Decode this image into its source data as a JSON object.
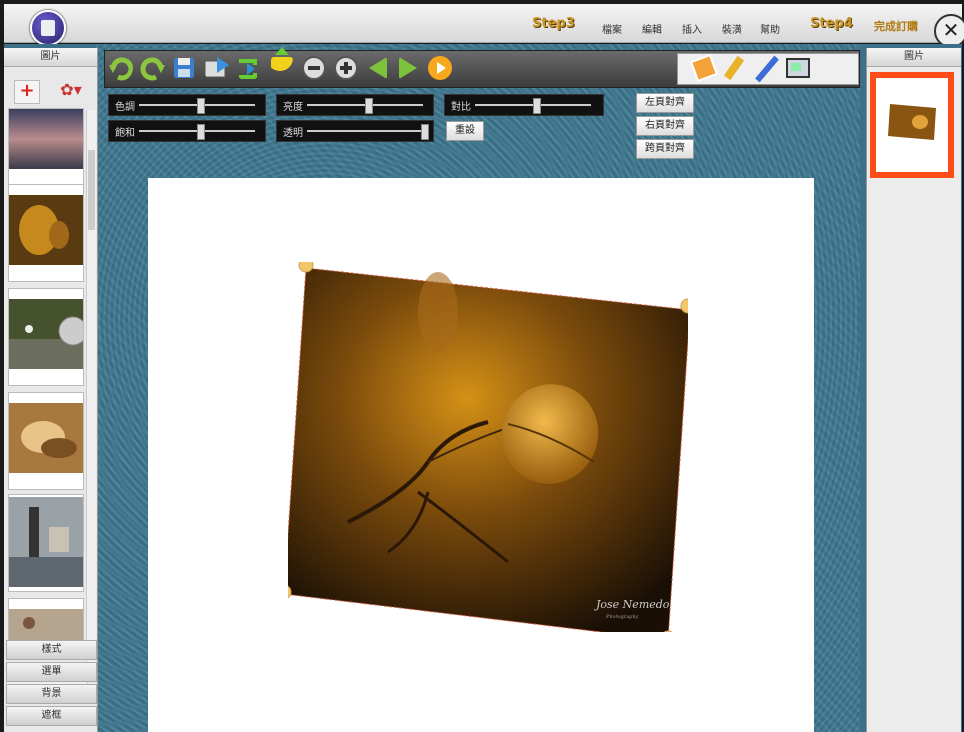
{
  "header": {
    "step3": "Step3",
    "menu": [
      "檔案",
      "編輯",
      "插入",
      "裝潢",
      "幫助"
    ],
    "step4": "Step4",
    "finish": "完成訂購",
    "close": "✕"
  },
  "left_panel": {
    "title": "圖片",
    "add_label": "+",
    "settings_label": "✿▾",
    "sections": [
      "樣式",
      "選單",
      "背景",
      "遮框"
    ]
  },
  "adjustments": {
    "hue": "色調",
    "brightness": "亮度",
    "contrast": "對比",
    "saturation": "飽和",
    "transparency": "透明",
    "reset": "重設",
    "hue_level": 0.5,
    "brightness_level": 0.5,
    "contrast_level": 0.5,
    "saturation_level": 0.5,
    "transparency_level": 1.0
  },
  "align_buttons": [
    "左頁對齊",
    "右頁對齊",
    "跨頁對齊"
  ],
  "right_panel": {
    "title": "圖片"
  },
  "photo": {
    "watermark": "Jose Nemedo",
    "watermark_sub": "Photography"
  },
  "colors": {
    "accent_orange": "#ff4d18",
    "bg_teal": "#3f7a93",
    "step_gold": "#c9962a"
  }
}
